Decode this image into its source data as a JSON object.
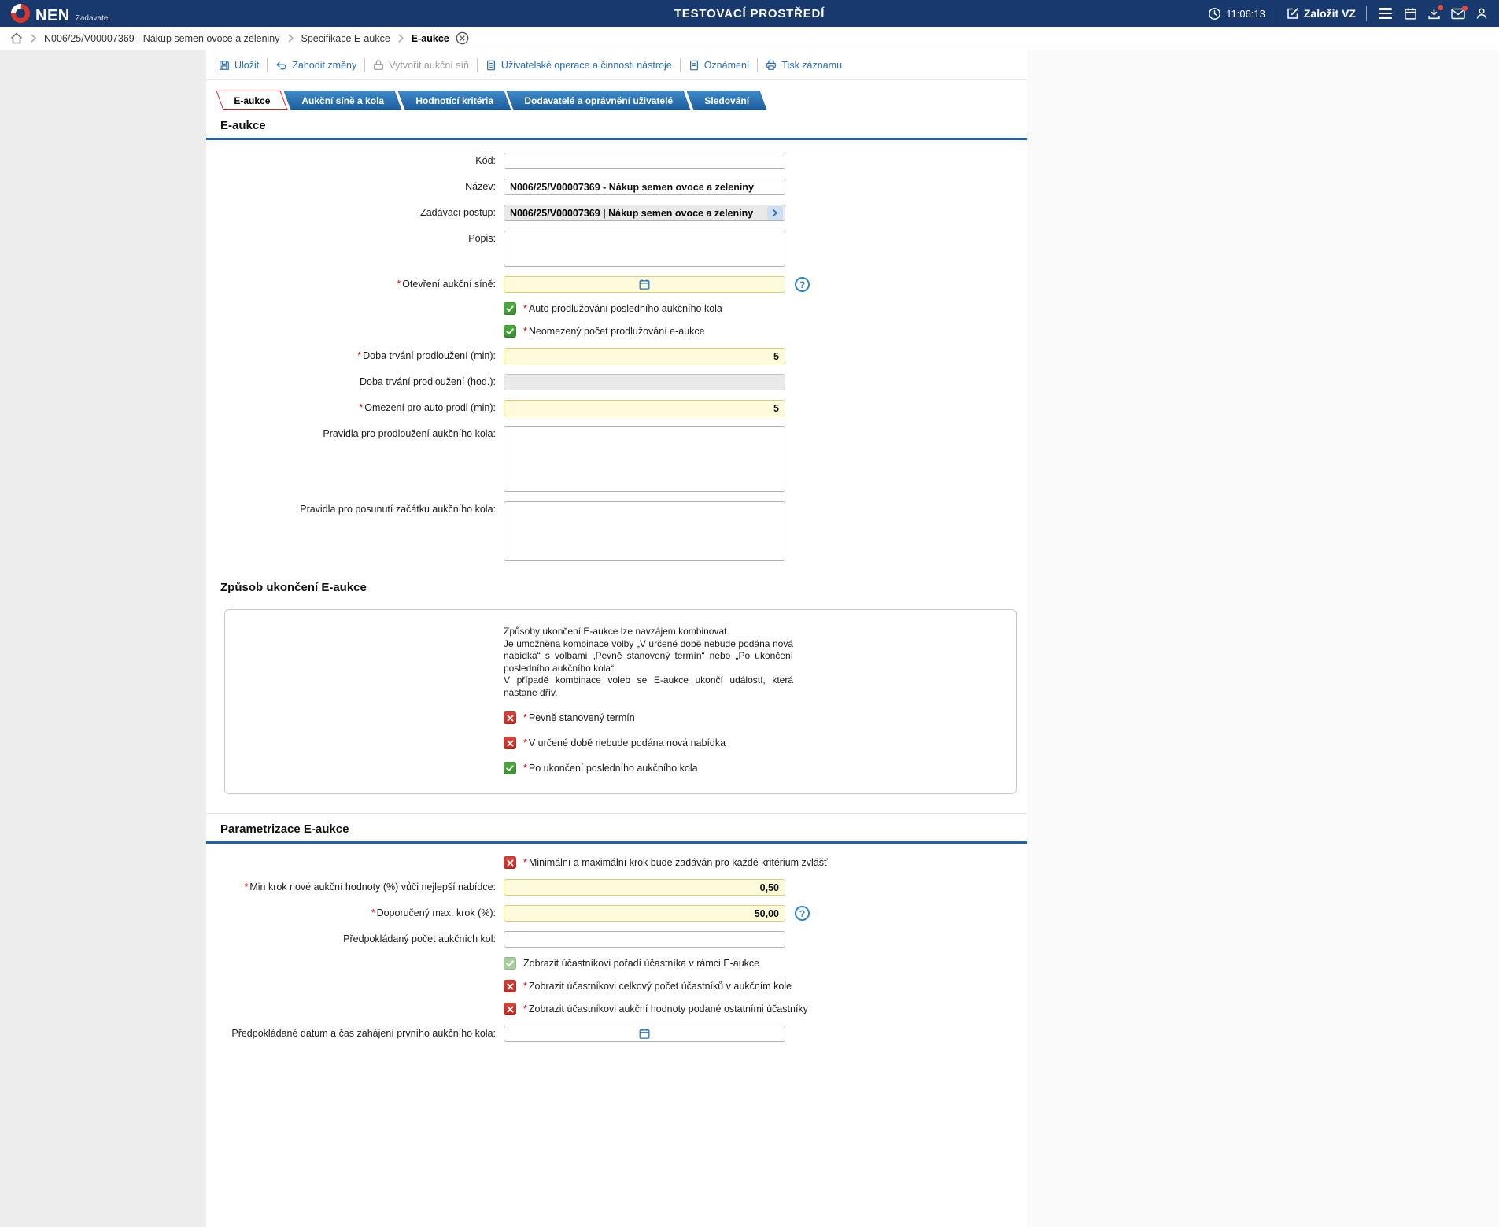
{
  "ui": {
    "required_marker": "*",
    "help_glyph": "?"
  },
  "header": {
    "logo_text": "NEN",
    "logo_subtitle": "Zadavatel",
    "environment": "TESTOVACÍ PROSTŘEDÍ",
    "time": "11:06:13",
    "create_vz": "Založit VZ"
  },
  "breadcrumb": {
    "items": [
      "N006/25/V00007369 - Nákup semen ovoce a zeleniny",
      "Specifikace E-aukce",
      "E-aukce"
    ]
  },
  "toolbar": {
    "save": "Uložit",
    "discard": "Zahodit změny",
    "create_auction_room": "Vytvořit aukční síň",
    "user_operations": "Uživatelské operace a činnosti nástroje",
    "notifications": "Oznámení",
    "print": "Tisk záznamu"
  },
  "tabs": [
    "E-aukce",
    "Aukční síně a kola",
    "Hodnotící kritéria",
    "Dodavatelé a oprávnění uživatelé",
    "Sledování"
  ],
  "section_eaukce": {
    "title": "E-aukce",
    "kod": {
      "label": "Kód:",
      "value": ""
    },
    "nazev": {
      "label": "Název:",
      "value": "N006/25/V00007369 - Nákup semen ovoce a zeleniny"
    },
    "zadavaci_postup": {
      "label": "Zadávací postup:",
      "value": "N006/25/V00007369 | Nákup semen ovoce a zeleniny"
    },
    "popis": {
      "label": "Popis:",
      "value": ""
    },
    "otevreni_sine": {
      "label": "Otevření aukční síně:",
      "value": ""
    },
    "auto_prodluzovani": {
      "label": "Auto prodlužování posledního aukčního kola"
    },
    "neomezeny_pocet": {
      "label": "Neomezený počet prodlužování e-aukce"
    },
    "doba_trvani_min": {
      "label": "Doba trvání prodloužení (min):",
      "value": "5"
    },
    "doba_trvani_hod": {
      "label": "Doba trvání prodloužení (hod.):",
      "value": ""
    },
    "omezeni_auto_prodl": {
      "label": "Omezení pro auto prodl (min):",
      "value": "5"
    },
    "pravidla_prodlouzeni": {
      "label": "Pravidla pro prodloužení aukčního kola:",
      "value": ""
    },
    "pravidla_posunuti": {
      "label": "Pravidla pro posunutí začátku aukčního kola:",
      "value": ""
    }
  },
  "section_zpusob": {
    "title": "Způsob ukončení E-aukce",
    "info": [
      "Způsoby ukončení E-aukce lze navzájem kombinovat.",
      "Je umožněna kombinace volby „V určené době nebude podána nová nabídka“ s volbami „Pevně stanovený termín“ nebo „Po ukončení posledního aukčního kola“.",
      "V případě kombinace voleb se E-aukce ukončí událostí, která nastane dřív."
    ],
    "pevny_termin": {
      "label": "Pevně stanovený termín"
    },
    "nova_nabidka": {
      "label": "V určené době nebude podána nová nabídka"
    },
    "posledni_kolo": {
      "label": "Po ukončení posledního aukčního kola"
    }
  },
  "section_parametrizace": {
    "title": "Parametrizace E-aukce",
    "min_max_krok": {
      "label": "Minimální a maximální krok bude zadáván pro každé kritérium zvlášť"
    },
    "min_krok": {
      "label": "Min krok nové aukční hodnoty (%) vůči nejlepší nabídce:",
      "value": "0,50"
    },
    "max_krok": {
      "label": "Doporučený max. krok (%):",
      "value": "50,00"
    },
    "pocet_kol": {
      "label": "Předpokládaný počet aukčních kol:",
      "value": ""
    },
    "zobrazit_poradi": {
      "label": "Zobrazit účastníkovi pořadí účastníka v rámci E-aukce"
    },
    "zobrazit_pocet": {
      "label": "Zobrazit účastníkovi celkový počet účastníků v aukčním kole"
    },
    "zobrazit_hodnoty": {
      "label": "Zobrazit účastníkovi aukční hodnoty podané ostatními účastníky"
    },
    "datum_zahajeni": {
      "label": "Předpokládané datum a čas zahájení prvního aukčního kola:",
      "value": ""
    }
  }
}
